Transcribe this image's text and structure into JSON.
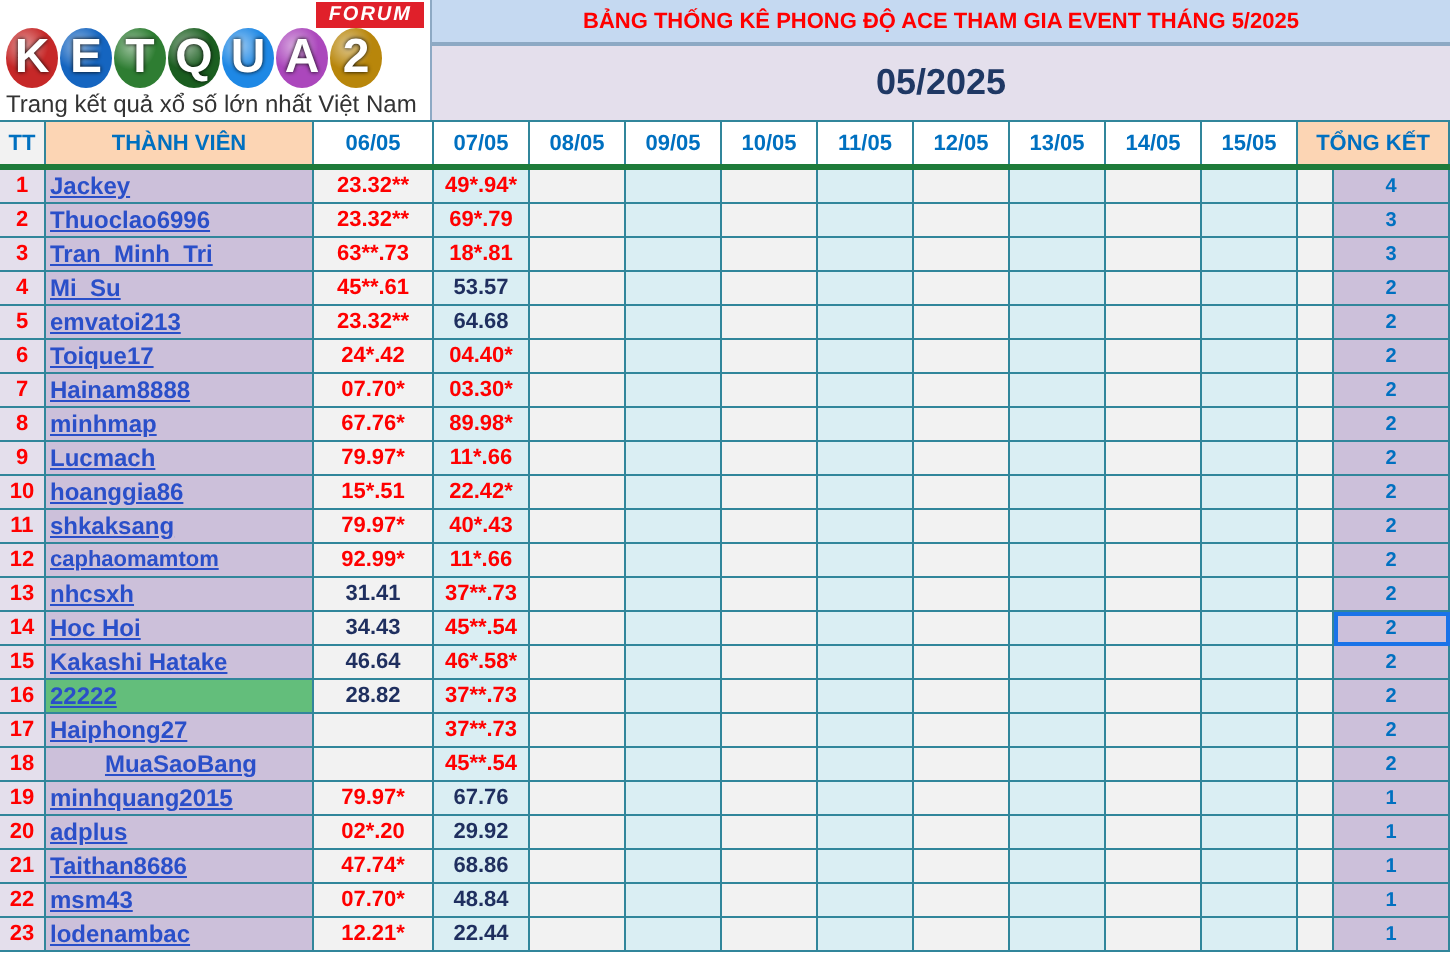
{
  "logo": {
    "letters": [
      {
        "char": "K",
        "color": "#c62828"
      },
      {
        "char": "E",
        "color": "#1565c0"
      },
      {
        "char": "T",
        "color": "#2e7d32"
      },
      {
        "char": "Q",
        "color": "#1b5e20"
      },
      {
        "char": "U",
        "color": "#1e88e5"
      },
      {
        "char": "A",
        "color": "#ab47bc"
      },
      {
        "char": "2",
        "color": "#b8860b"
      }
    ],
    "badge": "FORUM",
    "tagline": "Trang kết quả xổ số lớn nhất Việt Nam"
  },
  "title": "BẢNG THỐNG KÊ PHONG ĐỘ ACE THAM GIA EVENT THÁNG 5/2025",
  "month": "05/2025",
  "columns": {
    "index": "TT",
    "member": "THÀNH VIÊN",
    "dates": [
      "06/05",
      "07/05",
      "08/05",
      "09/05",
      "10/05",
      "11/05",
      "12/05",
      "13/05",
      "14/05",
      "15/05"
    ],
    "total": "TỔNG KẾT"
  },
  "rows": [
    {
      "tt": "1",
      "name": "Jackey",
      "kind": "plain",
      "day_1": {
        "text": "23.32**",
        "hit": true
      },
      "day_2": {
        "text": "49*.94*",
        "hit": true
      },
      "total": {
        "text": "4",
        "selected": false
      }
    },
    {
      "tt": "2",
      "name": "Thuoclao6996",
      "kind": "plain",
      "day_1": {
        "text": "23.32**",
        "hit": true
      },
      "day_2": {
        "text": "69*.79",
        "hit": true
      },
      "total": {
        "text": "3",
        "selected": false
      }
    },
    {
      "tt": "3",
      "name": "Tran_Minh_Tri",
      "kind": "plain",
      "day_1": {
        "text": "63**.73",
        "hit": true
      },
      "day_2": {
        "text": "18*.81",
        "hit": true
      },
      "total": {
        "text": "3",
        "selected": false
      }
    },
    {
      "tt": "4",
      "name": "Mi_Su",
      "kind": "plain",
      "day_1": {
        "text": "45**.61",
        "hit": true
      },
      "day_2": {
        "text": "53.57",
        "hit": false
      },
      "total": {
        "text": "2",
        "selected": false
      }
    },
    {
      "tt": "5",
      "name": "emvatoi213",
      "kind": "plain",
      "day_1": {
        "text": "23.32**",
        "hit": true
      },
      "day_2": {
        "text": "64.68",
        "hit": false
      },
      "total": {
        "text": "2",
        "selected": false
      }
    },
    {
      "tt": "6",
      "name": "Toique17",
      "kind": "plain",
      "day_1": {
        "text": "24*.42",
        "hit": true
      },
      "day_2": {
        "text": "04.40*",
        "hit": true
      },
      "total": {
        "text": "2",
        "selected": false
      }
    },
    {
      "tt": "7",
      "name": "Hainam8888",
      "kind": "plain",
      "day_1": {
        "text": "07.70*",
        "hit": true
      },
      "day_2": {
        "text": "03.30*",
        "hit": true
      },
      "total": {
        "text": "2",
        "selected": false
      }
    },
    {
      "tt": "8",
      "name": "minhmap",
      "kind": "plain",
      "day_1": {
        "text": "67.76*",
        "hit": true
      },
      "day_2": {
        "text": "89.98*",
        "hit": true
      },
      "total": {
        "text": "2",
        "selected": false
      }
    },
    {
      "tt": "9",
      "name": "Lucmach",
      "kind": "plain",
      "day_1": {
        "text": "79.97*",
        "hit": true
      },
      "day_2": {
        "text": "11*.66",
        "hit": true
      },
      "total": {
        "text": "2",
        "selected": false
      }
    },
    {
      "tt": "10",
      "name": "hoanggia86",
      "kind": "plain",
      "day_1": {
        "text": "15*.51",
        "hit": true
      },
      "day_2": {
        "text": "22.42*",
        "hit": true
      },
      "total": {
        "text": "2",
        "selected": false
      }
    },
    {
      "tt": "11",
      "name": "shkaksang",
      "kind": "plain",
      "day_1": {
        "text": "79.97*",
        "hit": true
      },
      "day_2": {
        "text": "40*.43",
        "hit": true
      },
      "total": {
        "text": "2",
        "selected": false
      }
    },
    {
      "tt": "12",
      "name": "caphaomamtom",
      "kind": "small",
      "day_1": {
        "text": "92.99*",
        "hit": true
      },
      "day_2": {
        "text": "11*.66",
        "hit": true
      },
      "total": {
        "text": "2",
        "selected": false
      }
    },
    {
      "tt": "13",
      "name": "nhcsxh",
      "kind": "plain",
      "day_1": {
        "text": "31.41",
        "hit": false
      },
      "day_2": {
        "text": "37**.73",
        "hit": true
      },
      "total": {
        "text": "2",
        "selected": false
      }
    },
    {
      "tt": "14",
      "name": "Hoc Hoi",
      "kind": "plain",
      "day_1": {
        "text": "34.43",
        "hit": false
      },
      "day_2": {
        "text": "45**.54",
        "hit": true
      },
      "total": {
        "text": "2",
        "selected": true
      }
    },
    {
      "tt": "15",
      "name": "Kakashi Hatake",
      "kind": "plain",
      "day_1": {
        "text": "46.64",
        "hit": false
      },
      "day_2": {
        "text": "46*.58*",
        "hit": true
      },
      "total": {
        "text": "2",
        "selected": false
      }
    },
    {
      "tt": "16",
      "name": "22222",
      "kind": "highlight",
      "day_1": {
        "text": "28.82",
        "hit": false
      },
      "day_2": {
        "text": "37**.73",
        "hit": true
      },
      "total": {
        "text": "2",
        "selected": false
      }
    },
    {
      "tt": "17",
      "name": "Haiphong27",
      "kind": "plain",
      "day_2": {
        "text": "37**.73",
        "hit": true
      },
      "total": {
        "text": "2",
        "selected": false
      }
    },
    {
      "tt": "18",
      "name": "MuaSaoBang",
      "kind": "centered",
      "day_2": {
        "text": "45**.54",
        "hit": true
      },
      "total": {
        "text": "2",
        "selected": false
      }
    },
    {
      "tt": "19",
      "name": "minhquang2015",
      "kind": "plain",
      "day_1": {
        "text": "79.97*",
        "hit": true
      },
      "day_2": {
        "text": "67.76",
        "hit": false
      },
      "total": {
        "text": "1",
        "selected": false
      }
    },
    {
      "tt": "20",
      "name": "adplus",
      "kind": "plain",
      "day_1": {
        "text": "02*.20",
        "hit": true
      },
      "day_2": {
        "text": "29.92",
        "hit": false
      },
      "total": {
        "text": "1",
        "selected": false
      }
    },
    {
      "tt": "21",
      "name": "Taithan8686",
      "kind": "plain",
      "day_1": {
        "text": "47.74*",
        "hit": true
      },
      "day_2": {
        "text": "68.86",
        "hit": false
      },
      "total": {
        "text": "1",
        "selected": false
      }
    },
    {
      "tt": "22",
      "name": "msm43",
      "kind": "plain",
      "day_1": {
        "text": "07.70*",
        "hit": true
      },
      "day_2": {
        "text": "48.84",
        "hit": false
      },
      "total": {
        "text": "1",
        "selected": false
      }
    },
    {
      "tt": "23",
      "name": "lodenambac",
      "kind": "plain",
      "day_1": {
        "text": "12.21*",
        "hit": true
      },
      "day_2": {
        "text": "22.44",
        "hit": false
      },
      "total": {
        "text": "1",
        "selected": false
      }
    }
  ]
}
